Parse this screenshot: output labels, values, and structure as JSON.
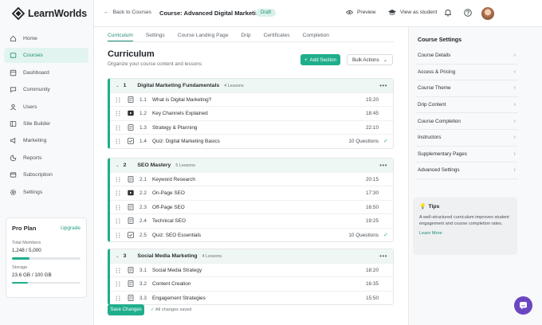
{
  "brand": {
    "name": "LearnWorlds",
    "accent": "#1fae8b"
  },
  "sidebar": {
    "items": [
      {
        "label": "Home",
        "icon": "home-icon"
      },
      {
        "label": "Courses",
        "icon": "courses-icon",
        "active": true
      },
      {
        "label": "Dashboard",
        "icon": "dashboard-icon"
      },
      {
        "label": "Community",
        "icon": "community-icon"
      },
      {
        "label": "Users",
        "icon": "users-icon"
      },
      {
        "label": "Site Builder",
        "icon": "site-builder-icon"
      },
      {
        "label": "Marketing",
        "icon": "marketing-icon"
      },
      {
        "label": "Reports",
        "icon": "reports-icon"
      },
      {
        "label": "Subscription",
        "icon": "subscription-icon"
      },
      {
        "label": "Settings",
        "icon": "settings-icon"
      }
    ],
    "plan": {
      "title": "Pro Plan",
      "upgrade": "Upgrade",
      "members_label": "Total Members",
      "members_value": "1,248 / 5,000",
      "members_fraction": 0.25,
      "storage_label": "Storage",
      "storage_value": "23.6 GB / 100 GB",
      "storage_fraction": 0.236
    }
  },
  "header": {
    "back": "Back to Courses",
    "course_title": "Course: Advanced Digital Marketing",
    "status": "Draft",
    "preview": "Preview",
    "view_as": "View as student"
  },
  "main": {
    "tabs": [
      "Curriculum",
      "Settings",
      "Course Landing Page",
      "Drip",
      "Certificates",
      "Completion"
    ],
    "title": "Curriculum",
    "subtitle": "Organize your course content and lessons",
    "add_section": "Add Section",
    "bulk_actions": "Bulk Actions",
    "save": "Save Changes",
    "saved_status": "All changes saved",
    "sections": [
      {
        "num": "1",
        "title": "Digital Marketing Fundamentals",
        "count": "4 Lessons",
        "lessons": [
          {
            "num": "1.1",
            "title": "What is Digital Marketing?",
            "meta": "15:20",
            "type": "doc"
          },
          {
            "num": "1.2",
            "title": "Key Channels Explained",
            "meta": "18:45",
            "type": "video"
          },
          {
            "num": "1.3",
            "title": "Strategy & Planning",
            "meta": "22:10",
            "type": "doc"
          },
          {
            "num": "1.4",
            "title": "Quiz: Digital Marketing Basics",
            "meta": "10 Questions",
            "type": "quiz",
            "done": true
          }
        ]
      },
      {
        "num": "2",
        "title": "SEO Mastery",
        "count": "5 Lessons",
        "lessons": [
          {
            "num": "2.1",
            "title": "Keyword Research",
            "meta": "20:15",
            "type": "doc"
          },
          {
            "num": "2.2",
            "title": "On-Page SEO",
            "meta": "17:30",
            "type": "video"
          },
          {
            "num": "2.3",
            "title": "Off-Page SEO",
            "meta": "16:50",
            "type": "doc"
          },
          {
            "num": "2.4",
            "title": "Technical SEO",
            "meta": "19:25",
            "type": "doc"
          },
          {
            "num": "2.5",
            "title": "Quiz: SEO Essentials",
            "meta": "10 Questions",
            "type": "quiz",
            "done": true
          }
        ]
      },
      {
        "num": "3",
        "title": "Social Media Marketing",
        "count": "4 Lessons",
        "lessons": [
          {
            "num": "3.1",
            "title": "Social Media Strategy",
            "meta": "18:20",
            "type": "doc"
          },
          {
            "num": "3.2",
            "title": "Content Creation",
            "meta": "16:35",
            "type": "doc"
          },
          {
            "num": "3.3",
            "title": "Engagement Strategies",
            "meta": "15:50",
            "type": "doc"
          }
        ]
      }
    ]
  },
  "settings_panel": {
    "title": "Course Settings",
    "items": [
      "Course Details",
      "Access & Pricing",
      "Course Theme",
      "Drip Content",
      "Course Completion",
      "Instructors",
      "Supplementary Pages",
      "Advanced Settings"
    ]
  },
  "tips": {
    "title": "Tips",
    "text": "A well-structured curriculum improves student engagement and course completion rates.",
    "link": "Learn More"
  }
}
